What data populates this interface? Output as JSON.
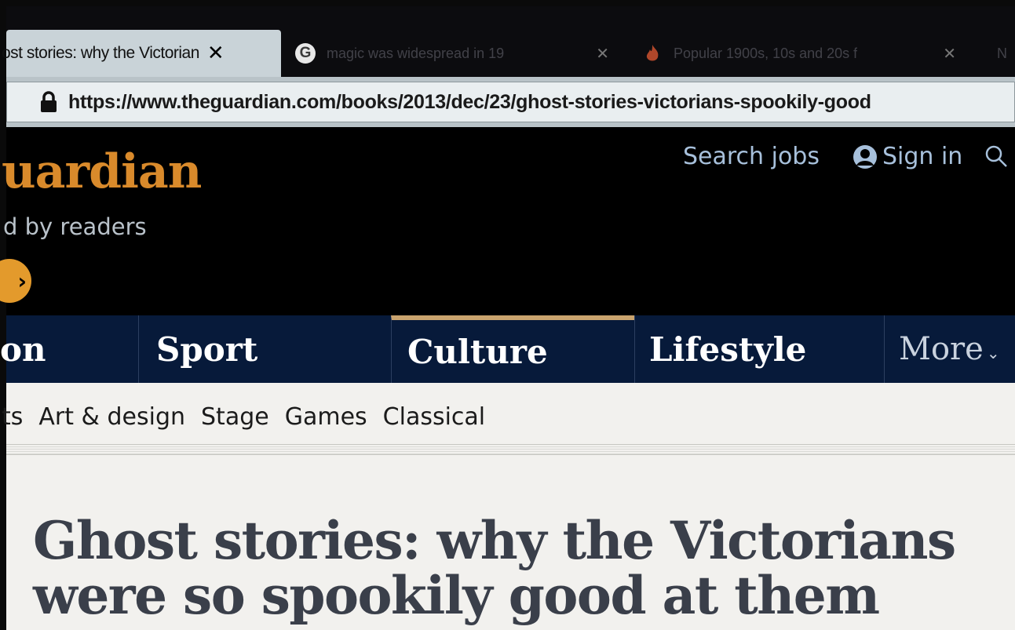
{
  "browser": {
    "tabs": [
      {
        "title": "ost stories: why the Victorian",
        "close": "✕",
        "active": true,
        "icon": "none"
      },
      {
        "title": "magic was widespread in 19",
        "close": "✕",
        "active": false,
        "icon": "google-icon",
        "icon_glyph": "G"
      },
      {
        "title": "Popular 1900s, 10s and 20s f",
        "close": "✕",
        "active": false,
        "icon": "fire-icon"
      },
      {
        "title": "N",
        "active": false
      }
    ],
    "url": "https://www.theguardian.com/books/2013/dec/23/ghost-stories-victorians-spookily-good"
  },
  "header": {
    "logo": "uardian",
    "tagline": "d by readers",
    "support_arrow": "›",
    "search_jobs": "Search jobs",
    "sign_in": "Sign in",
    "colors": {
      "logo": "#d98a2b",
      "background": "#000000",
      "links": "#a7c0db"
    }
  },
  "nav": {
    "items": [
      {
        "label": "on"
      },
      {
        "label": "Sport"
      },
      {
        "label": "Culture",
        "selected": true
      },
      {
        "label": "Lifestyle"
      },
      {
        "label": "More",
        "chevron": "⌄"
      }
    ],
    "colors": {
      "background": "#071a3a",
      "culture_accent": "#c9a36e"
    }
  },
  "subnav": {
    "items": [
      "ts",
      "Art & design",
      "Stage",
      "Games",
      "Classical"
    ]
  },
  "article": {
    "headline": "Ghost stories: why the Victorians were so spookily good at them"
  }
}
